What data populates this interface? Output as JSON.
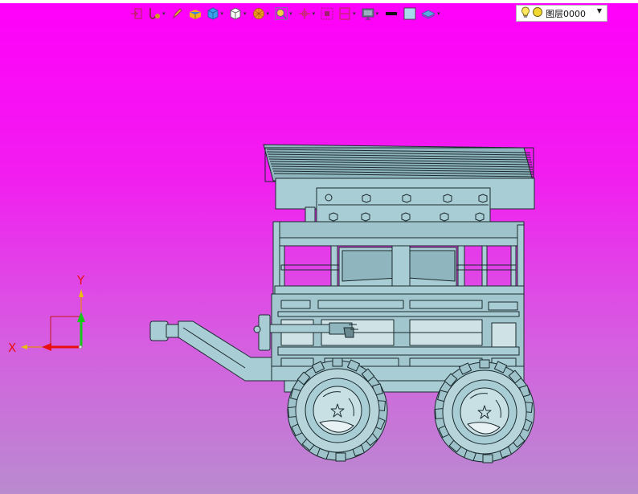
{
  "toolbar": {
    "items": [
      {
        "icon": "exit-sketch-icon",
        "has_dropdown": false
      },
      {
        "icon": "sketch-tools-icon",
        "has_dropdown": true
      },
      {
        "icon": "pencil-icon",
        "has_dropdown": false
      },
      {
        "icon": "shaded-solid-icon",
        "has_dropdown": false
      },
      {
        "icon": "cube-view-icon",
        "has_dropdown": true
      },
      {
        "icon": "view-orientation-icon",
        "has_dropdown": true
      },
      {
        "icon": "render-mode-icon",
        "has_dropdown": true
      },
      {
        "icon": "zoom-icon",
        "has_dropdown": true
      },
      {
        "icon": "snap-point-icon",
        "has_dropdown": true
      },
      {
        "icon": "selection-filter-icon",
        "has_dropdown": false
      },
      {
        "icon": "clipping-plane-icon",
        "has_dropdown": true
      },
      {
        "icon": "display-monitor-icon",
        "has_dropdown": true
      },
      {
        "icon": "line-color-icon",
        "has_dropdown": false
      },
      {
        "icon": "face-color-icon",
        "has_dropdown": false
      },
      {
        "icon": "layer-stack-icon",
        "has_dropdown": true
      }
    ]
  },
  "layer_select": {
    "value": "图层0000",
    "icons": [
      "lightbulb-icon",
      "layer-color-icon"
    ]
  },
  "viewport": {
    "background_top": "#ff00fa",
    "background_bottom": "#b98bcf",
    "model_color": "#a9cdd4",
    "edge_color": "#1a2a2e"
  },
  "triad": {
    "x_label": "X",
    "y_label": "Y",
    "x_color": "#e81010",
    "y_color": "#16c81a"
  }
}
